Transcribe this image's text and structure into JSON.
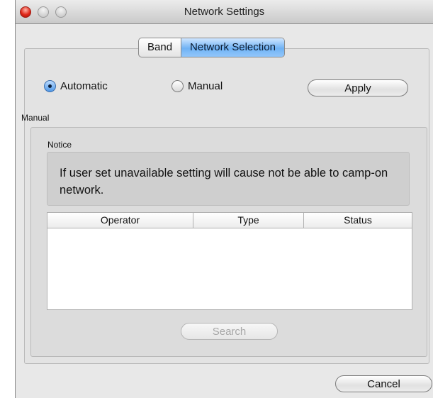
{
  "window": {
    "title": "Network Settings"
  },
  "tabs": [
    {
      "label": "Band",
      "selected": false
    },
    {
      "label": "Network Selection",
      "selected": true
    }
  ],
  "mode": {
    "automatic_label": "Automatic",
    "manual_label": "Manual",
    "selected": "Automatic",
    "apply_label": "Apply"
  },
  "manual_section": {
    "label": "Manual",
    "notice_label": "Notice",
    "notice_text": "If user set unavailable setting will cause not be able to camp-on network.",
    "table": {
      "columns": [
        "Operator",
        "Type",
        "Status"
      ],
      "rows": []
    },
    "search_label": "Search"
  },
  "footer": {
    "cancel_label": "Cancel"
  },
  "colors": {
    "accent": "#6fb2f4",
    "close_light": "#e0281a"
  }
}
